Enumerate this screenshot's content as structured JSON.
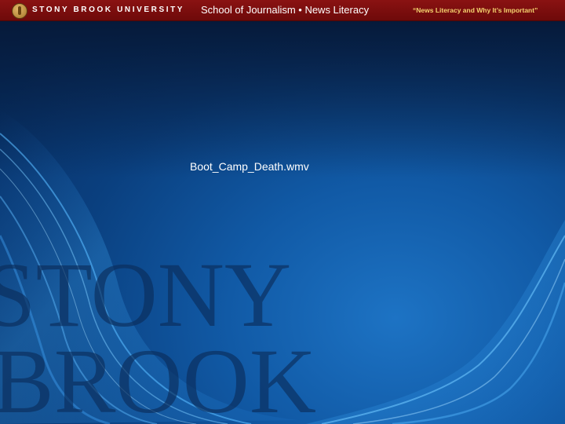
{
  "header": {
    "university": "STONY BROOK UNIVERSITY",
    "program": "School of Journalism • News Literacy",
    "tagline": "“News Literacy and Why It’s Important”"
  },
  "slide": {
    "media_filename": "Boot_Camp_Death.wmv"
  },
  "watermark": {
    "line1": "STONY",
    "line2": "BROOK"
  },
  "colors": {
    "header_bg": "#7a0e0e",
    "tagline": "#f4d26e",
    "background": "#0d4a91",
    "swirl": "#3aa3f0",
    "watermark": "#0a2c5a"
  }
}
